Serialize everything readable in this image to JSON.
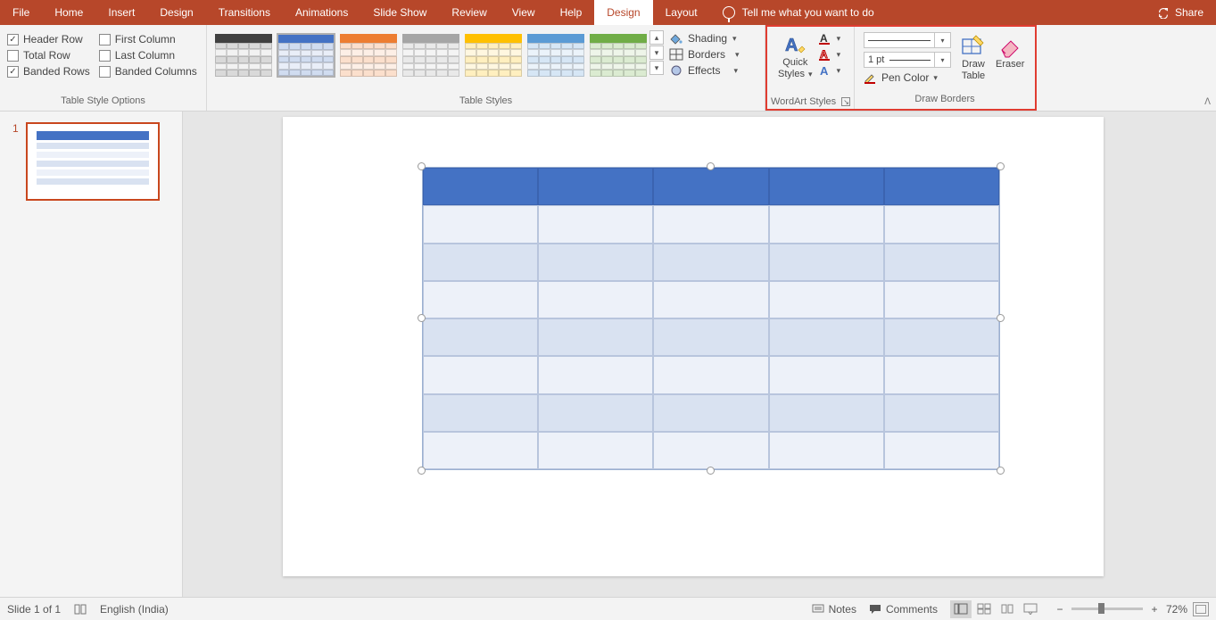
{
  "tabs": {
    "file": "File",
    "home": "Home",
    "insert": "Insert",
    "design": "Design",
    "transitions": "Transitions",
    "animations": "Animations",
    "slideshow": "Slide Show",
    "review": "Review",
    "view": "View",
    "help": "Help",
    "designCtx": "Design",
    "layout": "Layout",
    "tellme": "Tell me what you want to do",
    "share": "Share"
  },
  "opts": {
    "headerRow": "Header Row",
    "totalRow": "Total Row",
    "bandedRows": "Banded Rows",
    "firstCol": "First Column",
    "lastCol": "Last Column",
    "bandedCols": "Banded Columns"
  },
  "groups": {
    "styleOptions": "Table Style Options",
    "tableStyles": "Table Styles",
    "wordart": "WordArt Styles",
    "drawBorders": "Draw Borders"
  },
  "cmds": {
    "shading": "Shading",
    "borders": "Borders",
    "effects": "Effects",
    "quickStyles": "Quick",
    "stylesLine": "Styles",
    "penColor": "Pen Color",
    "drawTable": "Draw",
    "tableLine": "Table",
    "eraser": "Eraser",
    "pt": "1 pt"
  },
  "thumb": {
    "num": "1"
  },
  "status": {
    "slide": "Slide 1 of 1",
    "lang": "English (India)",
    "notes": "Notes",
    "comments": "Comments",
    "zoom": "72%"
  },
  "colors": {
    "accent": "#B7472A",
    "tableHeader": "#4472C4",
    "bandA": "#D9E2F1",
    "bandB": "#EDF1F9"
  },
  "stylePalette": [
    "#404040",
    "#4472C4",
    "#ED7D31",
    "#A5A5A5",
    "#FFC000",
    "#5B9BD5",
    "#70AD47"
  ],
  "checked": {
    "headerRow": true,
    "totalRow": false,
    "bandedRows": true,
    "firstCol": false,
    "lastCol": false,
    "bandedCols": false
  }
}
